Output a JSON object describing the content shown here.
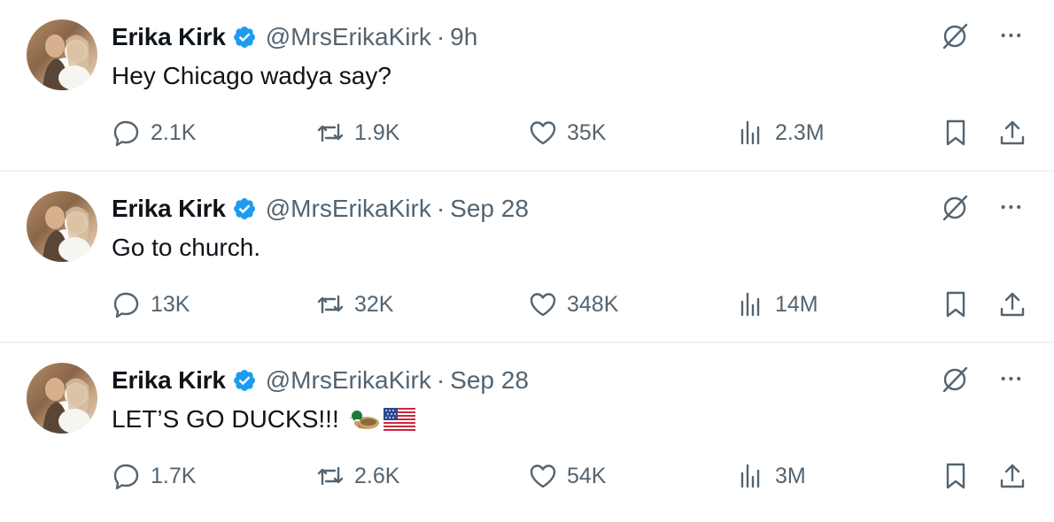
{
  "tweets": [
    {
      "name": "Erika Kirk",
      "handle": "@MrsErikaKirk",
      "separator": "·",
      "time": "9h",
      "text": "Hey Chicago wadya say?",
      "replies": "2.1K",
      "reposts": "1.9K",
      "likes": "35K",
      "views": "2.3M",
      "emojis": []
    },
    {
      "name": "Erika Kirk",
      "handle": "@MrsErikaKirk",
      "separator": "·",
      "time": "Sep 28",
      "text": "Go to church.",
      "replies": "13K",
      "reposts": "32K",
      "likes": "348K",
      "views": "14M",
      "emojis": []
    },
    {
      "name": "Erika Kirk",
      "handle": "@MrsErikaKirk",
      "separator": "·",
      "time": "Sep 28",
      "text": "LET’S GO DUCKS!!!",
      "replies": "1.7K",
      "reposts": "2.6K",
      "likes": "54K",
      "views": "3M",
      "emojis": [
        "duck-emoji",
        "us-flag-emoji"
      ]
    }
  ],
  "colors": {
    "verified_badge": "#1d9bf0",
    "secondary_text": "#536471",
    "primary_text": "#0f1419",
    "divider": "#eff3f4"
  },
  "icons": [
    "verified-badge-icon",
    "grok-icon",
    "more-icon",
    "reply-icon",
    "repost-icon",
    "like-icon",
    "views-icon",
    "bookmark-icon",
    "share-icon"
  ]
}
